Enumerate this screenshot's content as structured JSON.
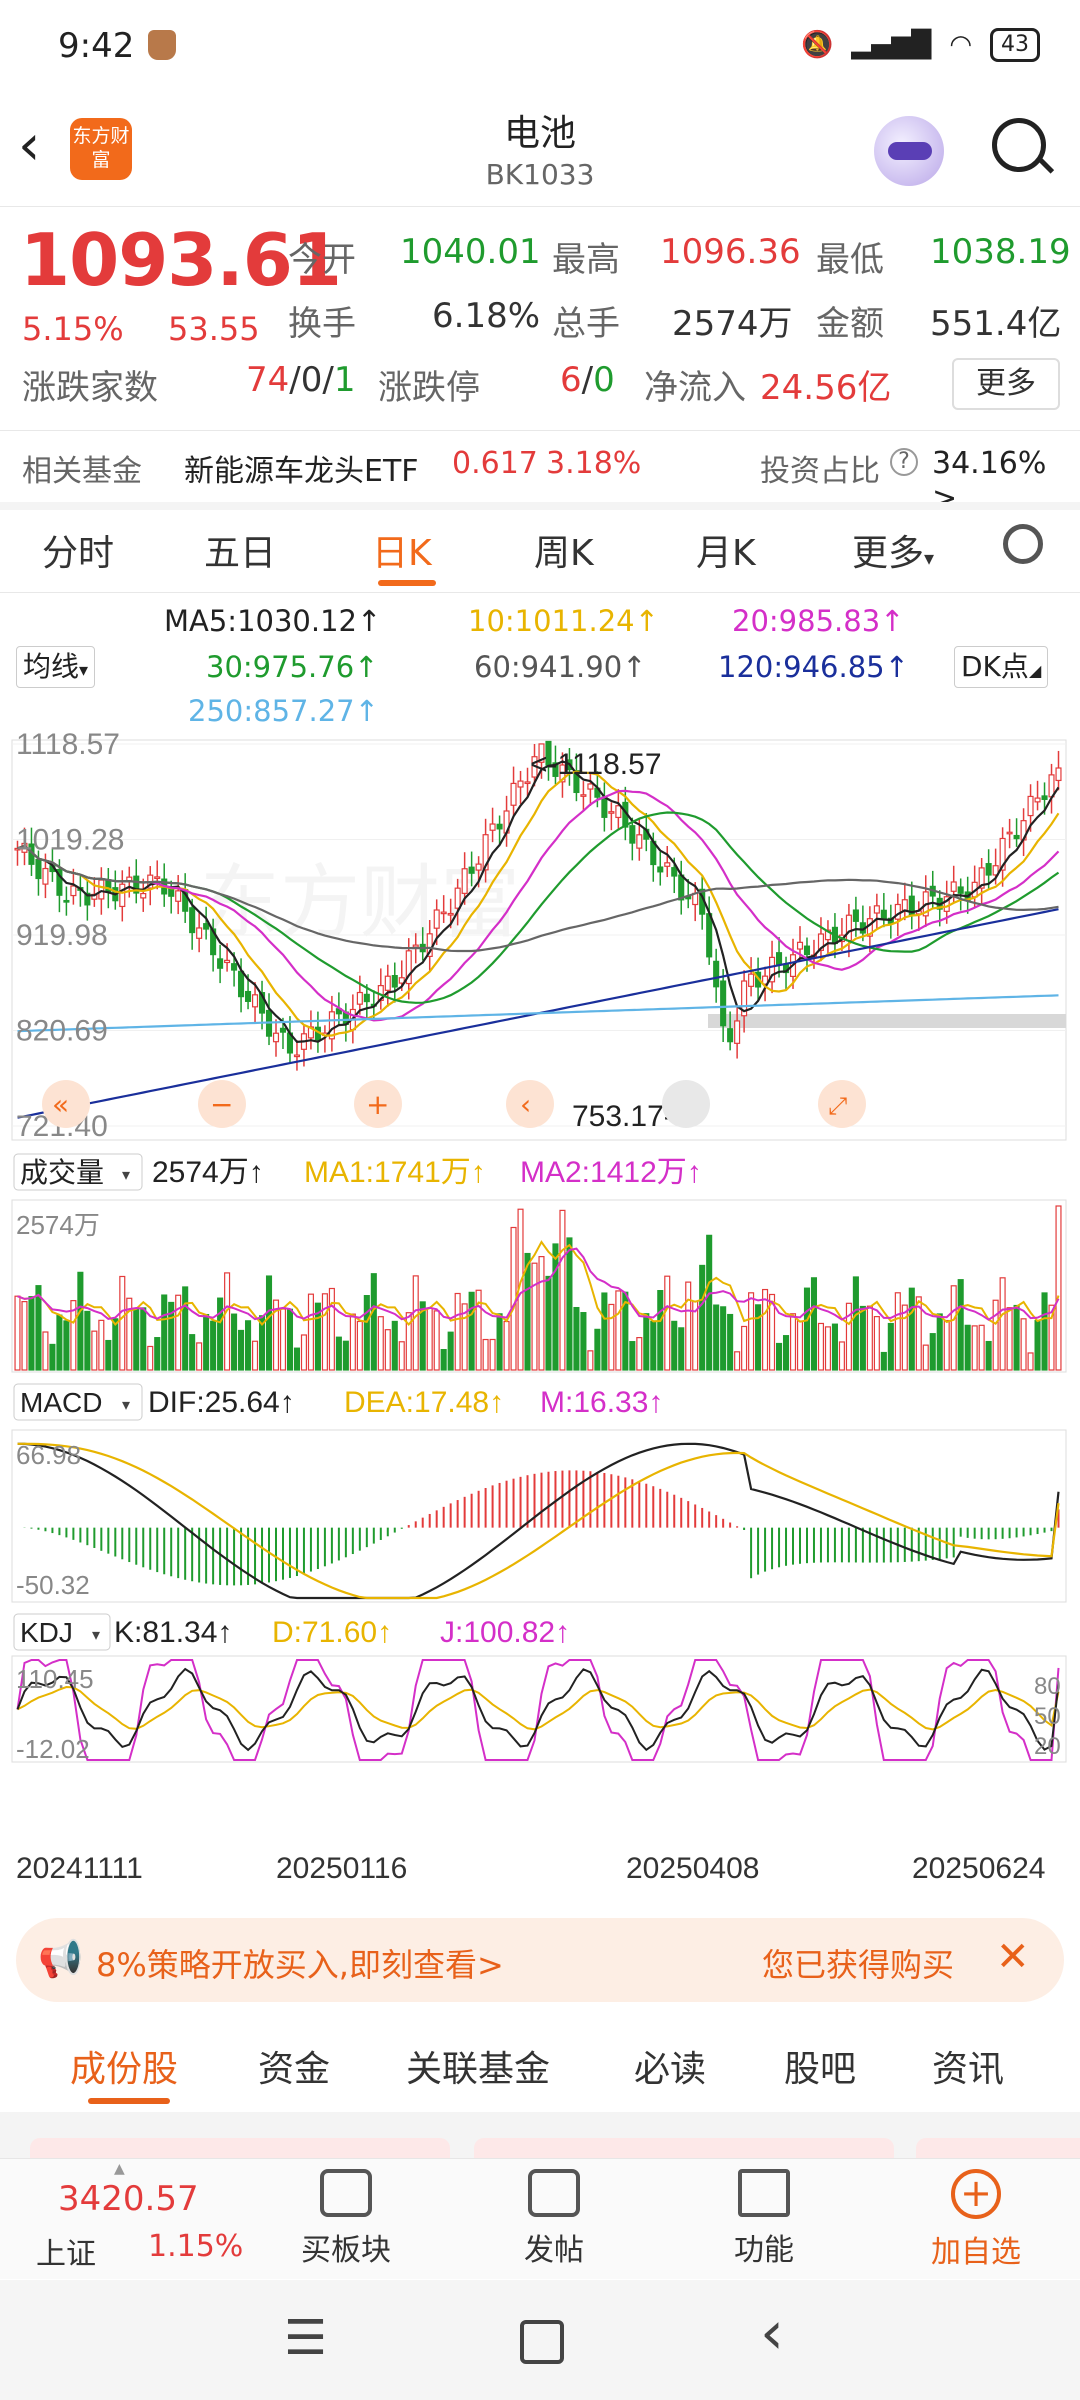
{
  "status": {
    "time": "9:42",
    "battery": "43"
  },
  "header": {
    "title": "电池",
    "code": "BK1033",
    "app_logo_text": "东方财富"
  },
  "quote": {
    "price": "1093.61",
    "change_pct": "5.15%",
    "change": "53.55",
    "open_label": "今开",
    "open": "1040.01",
    "high_label": "最高",
    "high": "1096.36",
    "low_label": "最低",
    "low": "1038.19",
    "turnover_label": "换手",
    "turnover": "6.18%",
    "volume_label": "总手",
    "volume": "2574万",
    "amount_label": "金额",
    "amount": "551.4亿",
    "updown_label": "涨跌家数",
    "up": "74",
    "flat": "/0/",
    "down": "1",
    "limit_label": "涨跌停",
    "limit_up": "6",
    "limit_sep": "/",
    "limit_down": "0",
    "netflow_label": "净流入",
    "netflow": "24.56亿",
    "more_label": "更多"
  },
  "fund": {
    "label": "相关基金",
    "name": "新能源车龙头ETF",
    "price": "0.617",
    "pct": "3.18%",
    "ratio_label": "投资占比",
    "ratio": "34.16% >"
  },
  "period_tabs": [
    "分时",
    "五日",
    "日K",
    "周K",
    "月K",
    "更多"
  ],
  "ma": {
    "toggle": "均线",
    "dk": "DK点",
    "ma5": "MA5:1030.12↑",
    "ma10": "10:1011.24↑",
    "ma20": "20:985.83↑",
    "ma30": "30:975.76↑",
    "ma60": "60:941.90↑",
    "ma120": "120:946.85↑",
    "ma250": "250:857.27↑"
  },
  "colors": {
    "up": "#e33b3b",
    "down": "#1f9b2e",
    "accent": "#f26a1b",
    "ma5": "#222222",
    "ma10": "#e8b400",
    "ma20": "#d42fc8",
    "ma30": "#1f9b2e",
    "ma60": "#666666",
    "ma120": "#1a2f9b",
    "ma250": "#5fb4e6"
  },
  "kline": {
    "y_ticks": [
      "1118.57",
      "1019.28",
      "919.98",
      "820.69",
      "721.40"
    ],
    "high_annotation": "<-1118.57",
    "low_annotation": "753.17->"
  },
  "volume_panel": {
    "toggle": "成交量",
    "value": "2574万↑",
    "ma1": "MA1:1741万↑",
    "ma2": "MA2:1412万↑",
    "top_tick": "2574万"
  },
  "macd_panel": {
    "toggle": "MACD",
    "dif": "DIF:25.64↑",
    "dea": "DEA:17.48↑",
    "m": "M:16.33↑",
    "top_tick": "66.98",
    "bottom_tick": "-50.32"
  },
  "kdj_panel": {
    "toggle": "KDJ",
    "k": "K:81.34↑",
    "d": "D:71.60↑",
    "j": "J:100.82↑",
    "top_tick": "110.45",
    "bottom_tick": "-12.02",
    "right_ticks": [
      "80",
      "50",
      "20"
    ]
  },
  "dates": [
    "20241111",
    "20250116",
    "20250408",
    "20250624"
  ],
  "chart_data": {
    "type": "candlestick",
    "title": "电池 日K",
    "ylim": [
      721.4,
      1118.57
    ],
    "y_ticks": [
      1118.57,
      1019.28,
      919.98,
      820.69,
      721.4
    ],
    "x_ticks": [
      "20241111",
      "20250116",
      "20250408",
      "20250624"
    ],
    "extremes": {
      "high": 1118.57,
      "low": 753.17
    },
    "last": {
      "open": 1040.01,
      "high": 1096.36,
      "low": 1038.19,
      "close": 1093.61
    },
    "moving_averages": {
      "MA5": 1030.12,
      "MA10": 1011.24,
      "MA20": 985.83,
      "MA30": 975.76,
      "MA60": 941.9,
      "MA120": 946.85,
      "MA250": 857.27
    },
    "volume": {
      "last": "2574万",
      "MA1": "1741万",
      "MA2": "1412万"
    },
    "macd": {
      "DIF": 25.64,
      "DEA": 17.48,
      "M": 16.33,
      "range": [
        -50.32,
        66.98
      ]
    },
    "kdj": {
      "K": 81.34,
      "D": 71.6,
      "J": 100.82,
      "range": [
        -12.02,
        110.45
      ]
    }
  },
  "banner": {
    "text": "8%策略开放买入,即刻查看>",
    "right_text": "您已获得购买"
  },
  "bottom_tabs": [
    "成份股",
    "资金",
    "关联基金",
    "必读",
    "股吧",
    "资讯"
  ],
  "toolbar": {
    "index_value": "3420.57",
    "index_name": "上证",
    "index_pct": "1.15%",
    "buy_block": "买板块",
    "post": "发帖",
    "functions": "功能",
    "add_watch": "加自选"
  }
}
